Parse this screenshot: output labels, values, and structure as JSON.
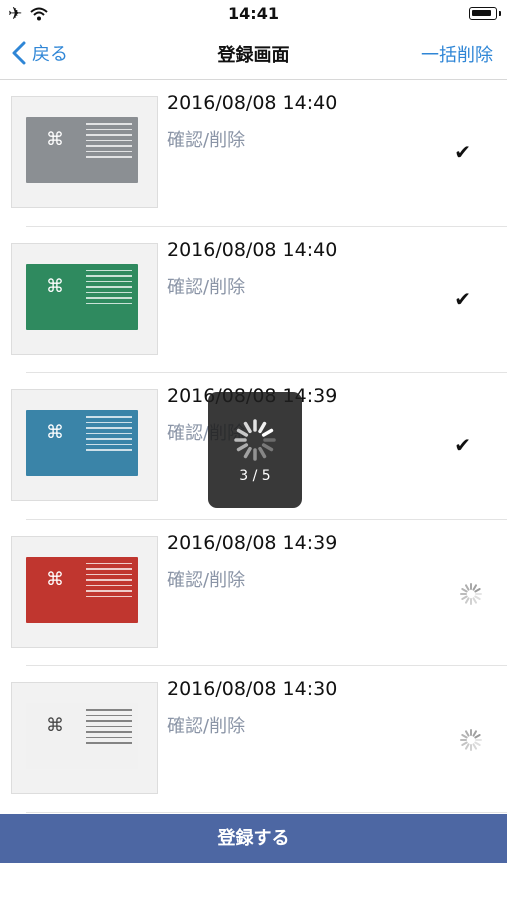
{
  "status_bar": {
    "time": "14:41",
    "airplane_icon": "airplane-icon",
    "wifi_icon": "wifi-icon",
    "battery_icon": "battery-icon"
  },
  "nav": {
    "back_label": "戻る",
    "title": "登録画面",
    "action_label": "一括削除",
    "accent_color": "#2f86d6"
  },
  "items": [
    {
      "date": "2016/08/08 14:40",
      "link": "確認/削除",
      "status": "✔",
      "state": "done",
      "card_color": "#8b8f93"
    },
    {
      "date": "2016/08/08 14:40",
      "link": "確認/削除",
      "status": "✔",
      "state": "done",
      "card_color": "#2f8a5f"
    },
    {
      "date": "2016/08/08 14:39",
      "link": "確認/削除",
      "status": "✔",
      "state": "done",
      "card_color": "#3a84a8"
    },
    {
      "date": "2016/08/08 14:39",
      "link": "確認/削除",
      "status": "",
      "state": "loading",
      "card_color": "#c0362f"
    },
    {
      "date": "2016/08/08 14:30",
      "link": "確認/削除",
      "status": "",
      "state": "loading",
      "card_color": "#f1f1f1"
    }
  ],
  "hud": {
    "progress_text": "3 / 5"
  },
  "register_button": {
    "label": "登録する",
    "color": "#4d67a3"
  }
}
